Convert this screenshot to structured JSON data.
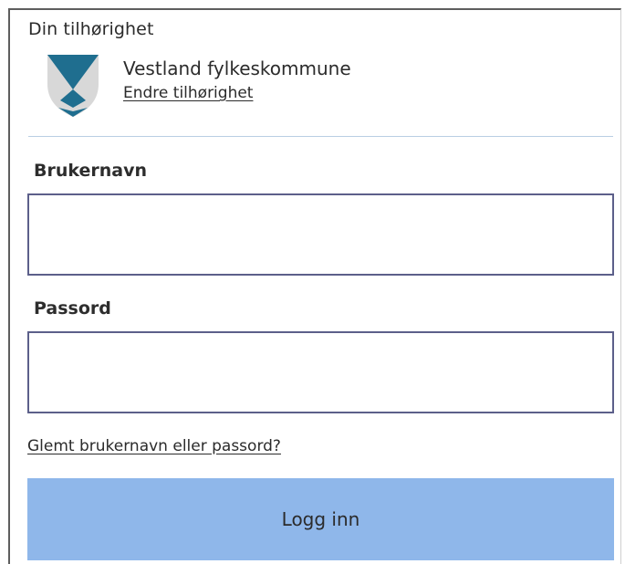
{
  "affiliation": {
    "heading": "Din tilhørighet",
    "organization": "Vestland fylkeskommune",
    "change_link": "Endre tilhørighet",
    "logo_icon": "county-crest-icon",
    "logo_colors": [
      "#1f6e8f",
      "#d8d8d8"
    ]
  },
  "form": {
    "username_label": "Brukernavn",
    "username_value": "",
    "password_label": "Passord",
    "password_value": "",
    "forgot_link": "Glemt brukernavn eller passord?",
    "login_button": "Logg inn"
  },
  "colors": {
    "button_background": "#8fb7ea",
    "input_border": "#5c5f8a",
    "divider": "#b9cfe3"
  }
}
